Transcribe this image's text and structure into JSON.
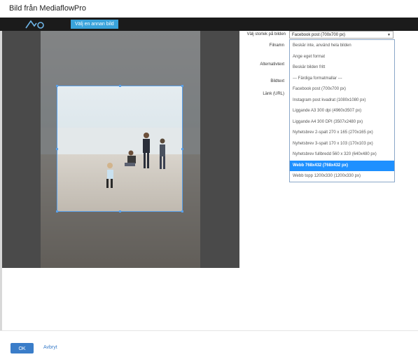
{
  "window": {
    "title": "Bild från MediaflowPro"
  },
  "toolbar": {
    "select_image_label": "Välj en annan bild"
  },
  "form": {
    "size_label": "Välj storlek på bilden",
    "filename_label": "Filnamn",
    "alt_text_label": "Alternativtext",
    "caption_label": "Bildtext",
    "link_label": "Länk (URL)",
    "size_value": "Facebook post (700x700 px)"
  },
  "dropdown": {
    "options": [
      "Beskär inte, använd hela bilden",
      "Ange eget format",
      "Beskär bilden fritt",
      "--- Färdiga formatmallar ---",
      "Facebook post (700x700 px)",
      "Instagram post kvadrat (1080x1080 px)",
      "Liggande A3 300 dpi (4960x3507 px)",
      "Liggande A4 300 DPI (3507x2480 px)",
      "Nyhetsbrev 2-spalt 270 x 165 (270x165 px)",
      "Nyhetsbrev 3-spalt 170 x 103 (170x103 px)",
      "Nyhetsbrev fullbredd 560 x 320 (640x480 px)",
      "Webb 768x432 (768x432 px)",
      "Webb topp 1200x330 (1200x330 px)"
    ],
    "selected_index": 11
  },
  "footer": {
    "ok_label": "OK",
    "cancel_label": "Avbryt"
  },
  "colors": {
    "accent": "#3aa3dc",
    "selected": "#1e90ff",
    "toolbar_bg": "#1b1b1b"
  },
  "icons": {
    "logo": "mediaflow-logo"
  }
}
